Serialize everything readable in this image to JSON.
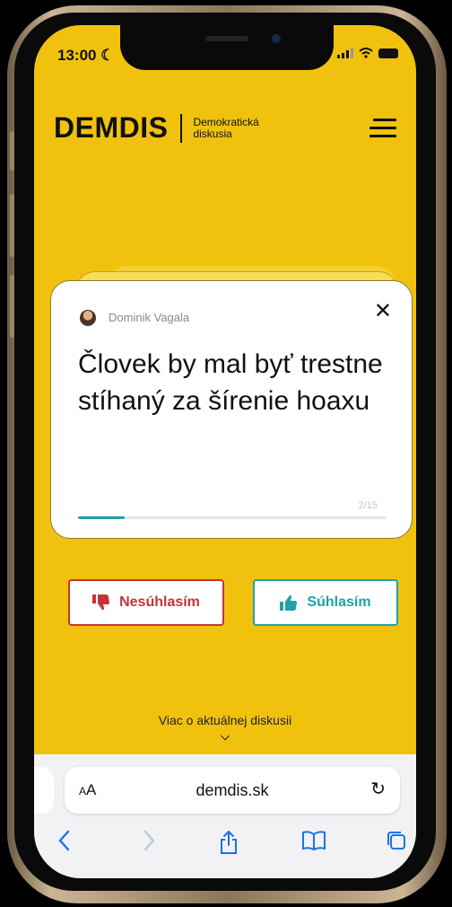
{
  "status": {
    "time": "13:00",
    "moon_icon": "moon-icon"
  },
  "header": {
    "logo": "DEMDIS",
    "tagline_line1": "Demokratická",
    "tagline_line2": "diskusia"
  },
  "card": {
    "author": "Dominik Vagala",
    "statement": "Človek by mal byť trestne stíhaný za šírenie hoaxu",
    "counter": "2/15",
    "progress": 0.15
  },
  "buttons": {
    "disagree": "Nesúhlasím",
    "agree": "Súhlasím"
  },
  "more_link": "Viac o aktuálnej diskusii",
  "browser": {
    "aa_big": "A",
    "aa_small": "A",
    "url": "demdis.sk"
  },
  "colors": {
    "background": "#f0c20e",
    "disagree": "#c63339",
    "agree": "#1fa3a8",
    "link": "#1a73e8"
  }
}
